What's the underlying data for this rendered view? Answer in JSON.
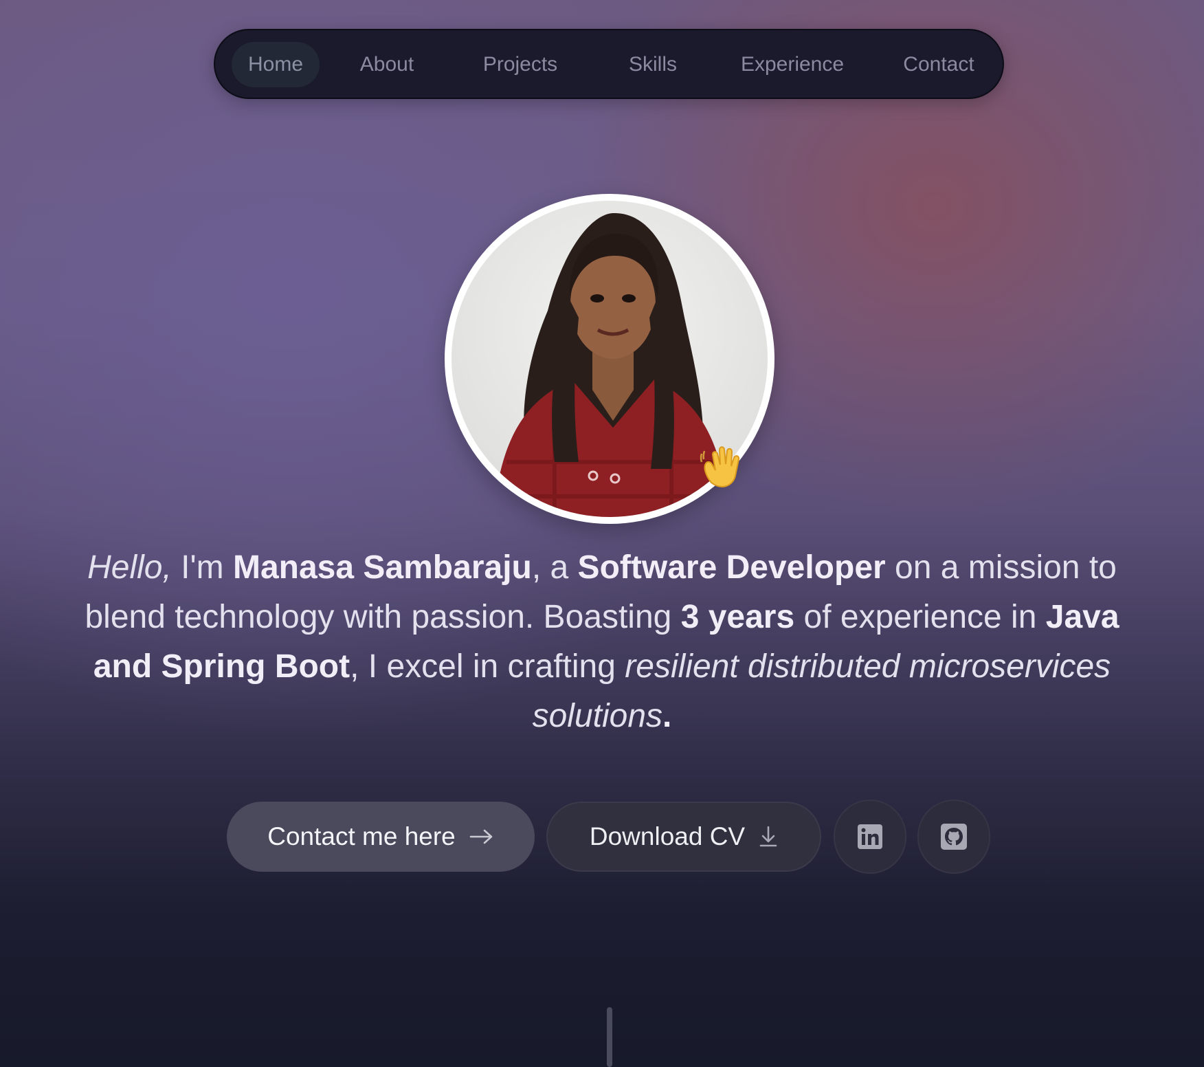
{
  "nav": {
    "items": [
      {
        "label": "Home",
        "active": true
      },
      {
        "label": "About",
        "active": false
      },
      {
        "label": "Projects",
        "active": false
      },
      {
        "label": "Skills",
        "active": false
      },
      {
        "label": "Experience",
        "active": false
      },
      {
        "label": "Contact",
        "active": false
      }
    ]
  },
  "hero": {
    "avatar_icon": "profile-photo",
    "badge_emoji": "waving-hand-icon",
    "intro": {
      "hello": "Hello,",
      "im": " I'm ",
      "name": "Manasa Sambaraju",
      "a": ", a ",
      "role": "Software Developer",
      "mission": " on a mission to blend technology with passion. Boasting ",
      "years": "3 years",
      "experience": " of experience in ",
      "stack": "Java and Spring Boot",
      "excel": ", I excel in crafting ",
      "specialty": "resilient distributed microservices solutions",
      "period": "."
    }
  },
  "actions": {
    "contact_label": "Contact me here",
    "contact_icon": "arrow-right-icon",
    "cv_label": "Download CV",
    "cv_icon": "download-icon",
    "linkedin_icon": "linkedin-icon",
    "github_icon": "github-icon"
  },
  "colors": {
    "nav_bg": "#1b1a2c",
    "primary_button": "#4a4a5c",
    "secondary_button": "#30303f",
    "text": "#e4e1ee"
  }
}
